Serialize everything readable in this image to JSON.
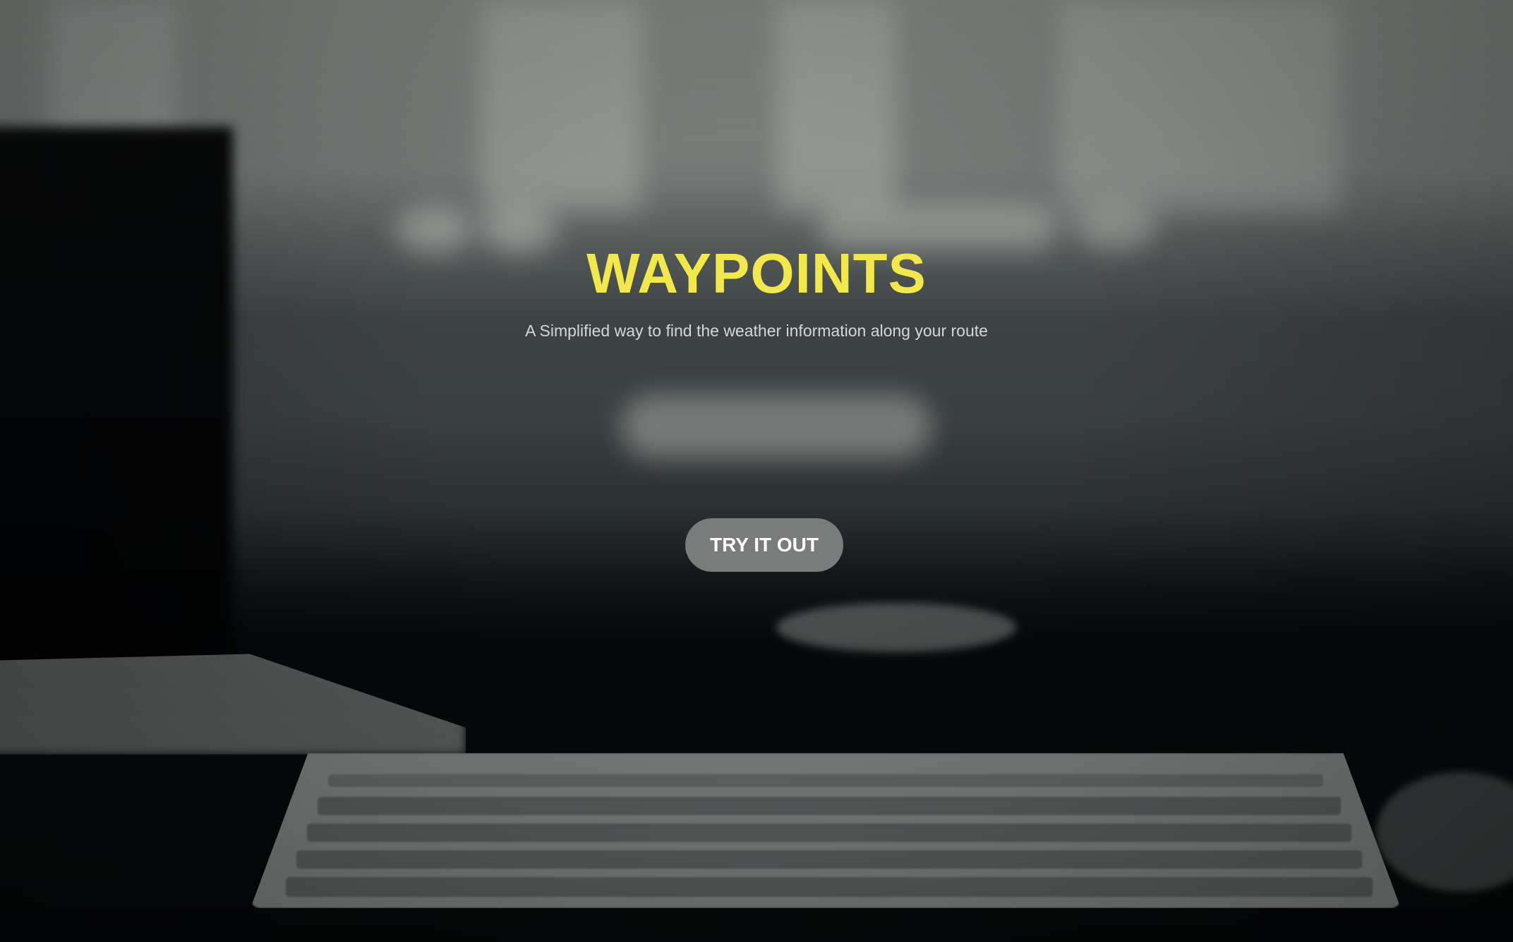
{
  "hero": {
    "title": "WAYPOINTS",
    "subtitle": "A Simplified way to find the weather information along your route",
    "cta_label": "TRY IT OUT"
  },
  "colors": {
    "title": "#f3e84a",
    "subtitle": "#d5d7d6",
    "button_bg": "#7a7b7b",
    "button_text": "#ffffff"
  },
  "background": {
    "description_icon": "desk-keyboard-photo"
  }
}
